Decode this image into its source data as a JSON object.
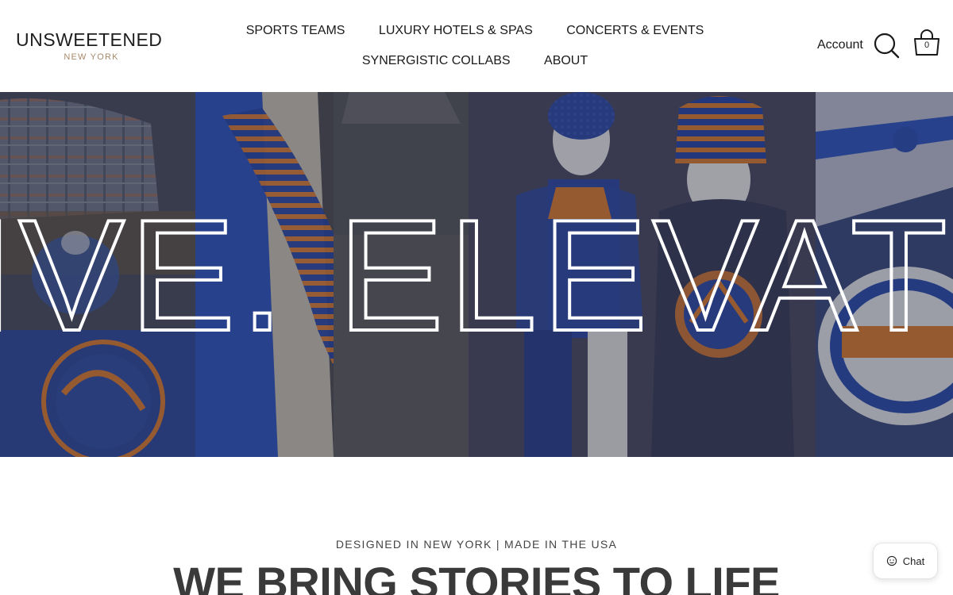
{
  "header": {
    "logo": {
      "main": "UNSWEETENED",
      "sub": "NEW YORK"
    },
    "nav": [
      "SPORTS TEAMS",
      "LUXURY HOTELS & SPAS",
      "CONCERTS & EVENTS",
      "SYNERGISTIC COLLABS",
      "ABOUT"
    ],
    "account_label": "Account",
    "cart_count": "0"
  },
  "hero": {
    "overlay_text": "IVE. ELEVATE"
  },
  "section": {
    "tagline": "DESIGNED IN NEW YORK | MADE IN THE USA",
    "headline": "WE BRING STORIES TO LIFE"
  },
  "chat": {
    "label": "Chat"
  },
  "colors": {
    "accent_orange": "#e87a2c",
    "navy": "#1f3f9a",
    "logo_sub": "#a8896a"
  }
}
